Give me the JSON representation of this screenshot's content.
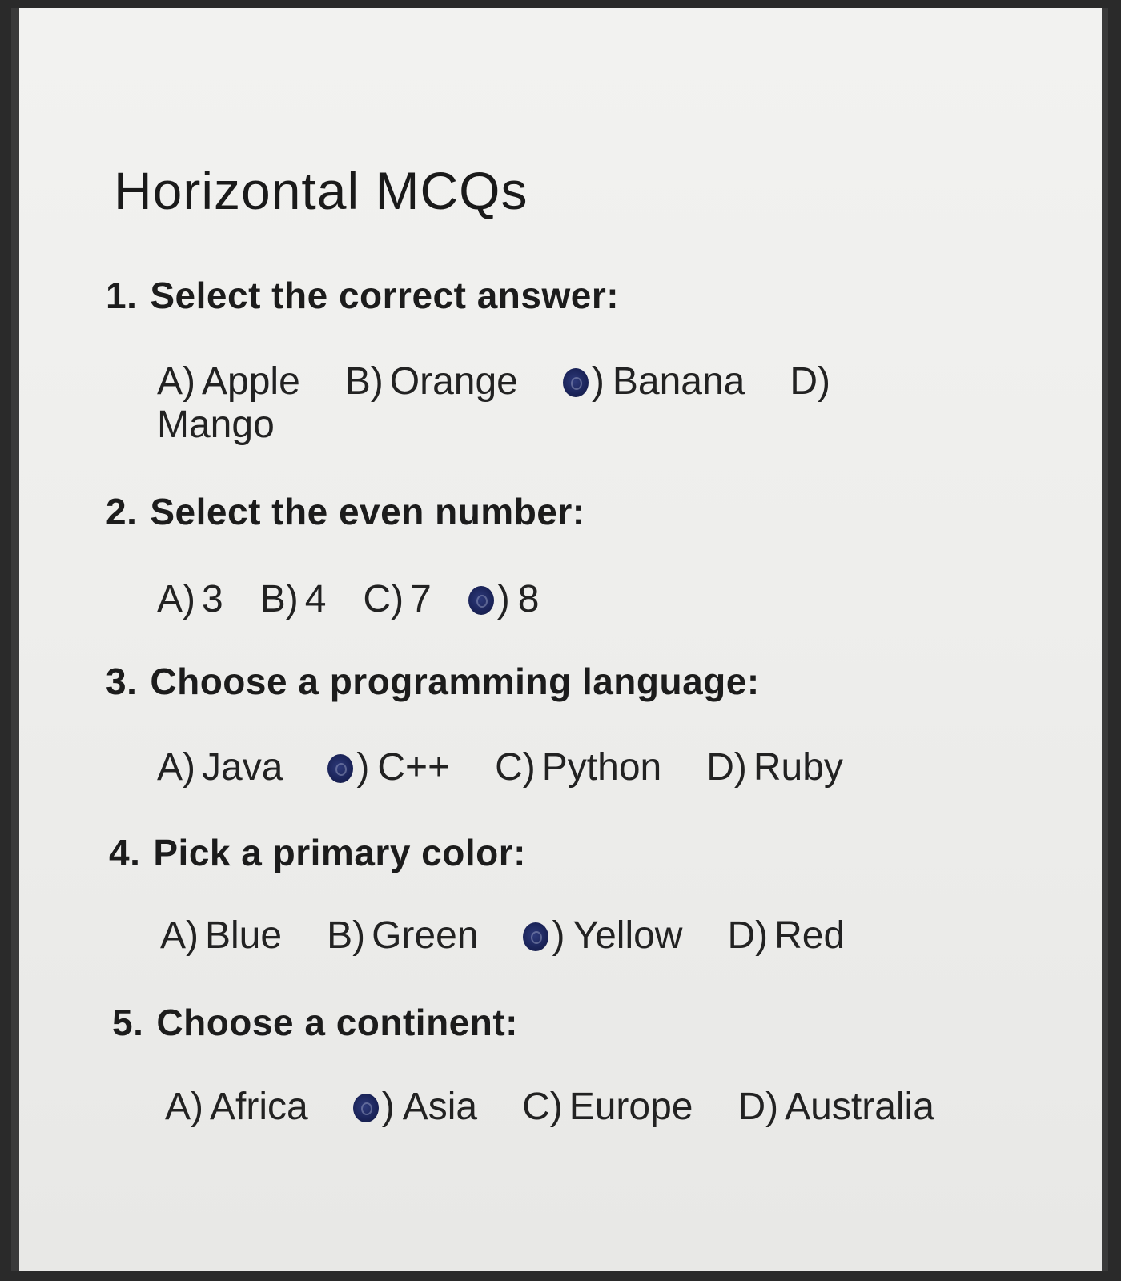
{
  "title": "Horizontal MCQs",
  "questions": [
    {
      "number": "1.",
      "text": "Select the correct answer:",
      "options": [
        {
          "letter": "A)",
          "text": "Apple",
          "selected": false
        },
        {
          "letter": "B)",
          "text": "Orange",
          "selected": false
        },
        {
          "letter": "C)",
          "text": "Banana",
          "selected": true
        },
        {
          "letter": "D)",
          "text": "Mango",
          "selected": false
        }
      ]
    },
    {
      "number": "2.",
      "text": "Select the even number:",
      "options": [
        {
          "letter": "A)",
          "text": "3",
          "selected": false
        },
        {
          "letter": "B)",
          "text": "4",
          "selected": false
        },
        {
          "letter": "C)",
          "text": "7",
          "selected": false
        },
        {
          "letter": "D)",
          "text": "8",
          "selected": true
        }
      ]
    },
    {
      "number": "3.",
      "text": "Choose a programming language:",
      "options": [
        {
          "letter": "A)",
          "text": "Java",
          "selected": false
        },
        {
          "letter": "B)",
          "text": "C++",
          "selected": true
        },
        {
          "letter": "C)",
          "text": "Python",
          "selected": false
        },
        {
          "letter": "D)",
          "text": "Ruby",
          "selected": false
        }
      ]
    },
    {
      "number": "4.",
      "text": "Pick a primary color:",
      "options": [
        {
          "letter": "A)",
          "text": "Blue",
          "selected": false
        },
        {
          "letter": "B)",
          "text": "Green",
          "selected": false
        },
        {
          "letter": "C)",
          "text": "Yellow",
          "selected": true
        },
        {
          "letter": "D)",
          "text": "Red",
          "selected": false
        }
      ]
    },
    {
      "number": "5.",
      "text": "Choose a continent:",
      "options": [
        {
          "letter": "A)",
          "text": "Africa",
          "selected": false
        },
        {
          "letter": "B)",
          "text": "Asia",
          "selected": true
        },
        {
          "letter": "C)",
          "text": "Europe",
          "selected": false
        },
        {
          "letter": "D)",
          "text": "Australia",
          "selected": false
        }
      ]
    }
  ],
  "colors": {
    "marked_bubble": "#1a2358",
    "paper": "#f0f0ee",
    "text": "#1d1d1d"
  }
}
